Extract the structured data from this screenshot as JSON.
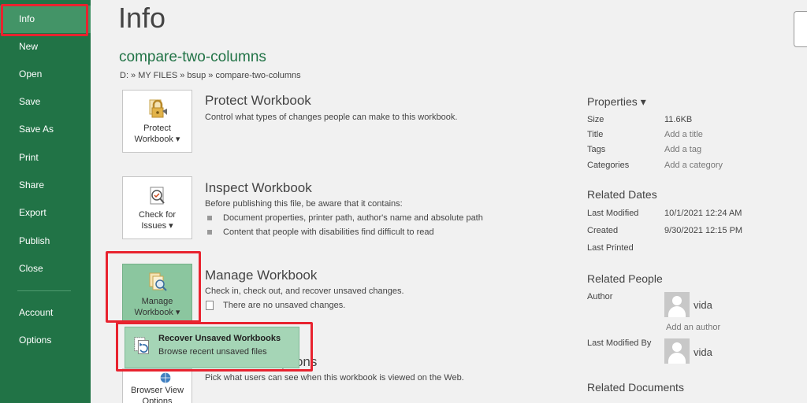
{
  "sidebar": {
    "items": [
      {
        "label": "Info"
      },
      {
        "label": "New"
      },
      {
        "label": "Open"
      },
      {
        "label": "Save"
      },
      {
        "label": "Save As"
      },
      {
        "label": "Print"
      },
      {
        "label": "Share"
      },
      {
        "label": "Export"
      },
      {
        "label": "Publish"
      },
      {
        "label": "Close"
      },
      {
        "label": "Account"
      },
      {
        "label": "Options"
      }
    ]
  },
  "main": {
    "title": "Info",
    "file_name": "compare-two-columns",
    "file_path": "D: » MY FILES » bsup » compare-two-columns",
    "protect": {
      "tile_line1": "Protect",
      "tile_line2": "Workbook ▾",
      "title": "Protect Workbook",
      "desc": "Control what types of changes people can make to this workbook."
    },
    "inspect": {
      "tile_line1": "Check for",
      "tile_line2": "Issues ▾",
      "title": "Inspect Workbook",
      "desc": "Before publishing this file, be aware that it contains:",
      "bullets": [
        "Document properties, printer path, author's name and absolute path",
        "Content that people with disabilities find difficult to read"
      ]
    },
    "manage": {
      "tile_line1": "Manage",
      "tile_line2": "Workbook ▾",
      "title": "Manage Workbook",
      "desc": "Check in, check out, and recover unsaved changes.",
      "note": "There are no unsaved changes."
    },
    "dropdown": {
      "title": "Recover Unsaved Workbooks",
      "subtitle": "Browse recent unsaved files"
    },
    "browser_view": {
      "tile_line1": "Browser View",
      "tile_line2": "Options",
      "title_partial": "ptions",
      "desc": "Pick what users can see when this workbook is viewed on the Web."
    }
  },
  "properties": {
    "header": "Properties ▾",
    "rows": [
      {
        "label": "Size",
        "value": "11.6KB"
      },
      {
        "label": "Title",
        "value": "Add a title"
      },
      {
        "label": "Tags",
        "value": "Add a tag"
      },
      {
        "label": "Categories",
        "value": "Add a category"
      }
    ],
    "related_dates": {
      "header": "Related Dates",
      "rows": [
        {
          "label": "Last Modified",
          "value": "10/1/2021 12:24 AM"
        },
        {
          "label": "Created",
          "value": "9/30/2021 12:15 PM"
        },
        {
          "label": "Last Printed",
          "value": ""
        }
      ]
    },
    "related_people": {
      "header": "Related People",
      "author_label": "Author",
      "author_name": "vida",
      "add_author": "Add an author",
      "last_modified_by_label": "Last Modified By",
      "last_modified_by_name": "vida"
    },
    "related_documents": {
      "header": "Related Documents"
    }
  },
  "colors": {
    "sidebar_bg": "#217346",
    "accent_green": "#217346",
    "highlight_red": "#e8232f"
  }
}
